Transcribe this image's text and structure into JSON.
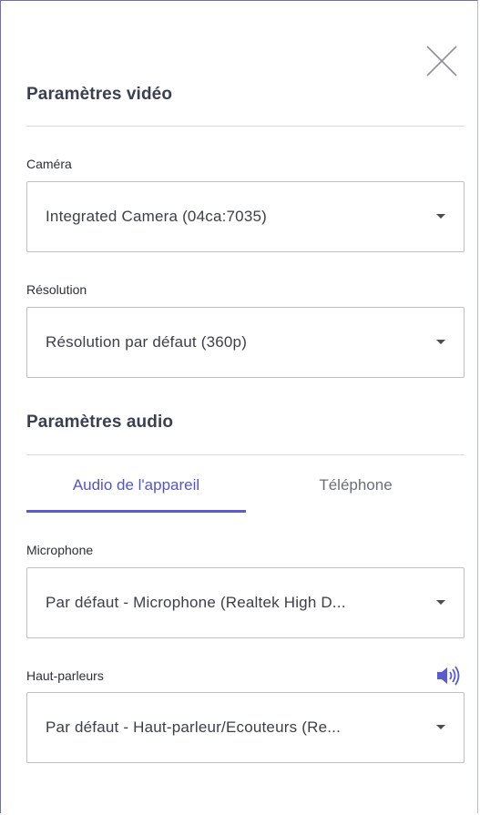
{
  "video": {
    "title": "Paramètres vidéo",
    "camera": {
      "label": "Caméra",
      "value": "Integrated Camera (04ca:7035)"
    },
    "resolution": {
      "label": "Résolution",
      "value": "Résolution par défaut (360p)"
    }
  },
  "audio": {
    "title": "Paramètres audio",
    "tabs": [
      {
        "label": "Audio de l'appareil",
        "active": true
      },
      {
        "label": "Téléphone",
        "active": false
      }
    ],
    "microphone": {
      "label": "Microphone",
      "value": "Par défaut - Microphone (Realtek High D..."
    },
    "speakers": {
      "label": "Haut-parleurs",
      "value": "Par défaut - Haut-parleur/Ecouteurs (Re..."
    }
  },
  "icons": {
    "close": "close-icon",
    "dropdown": "chevron-down-icon",
    "speaker": "speaker-icon"
  },
  "colors": {
    "accent": "#5a5bd0",
    "title": "#3a3f52",
    "text": "#3c3f4a"
  }
}
